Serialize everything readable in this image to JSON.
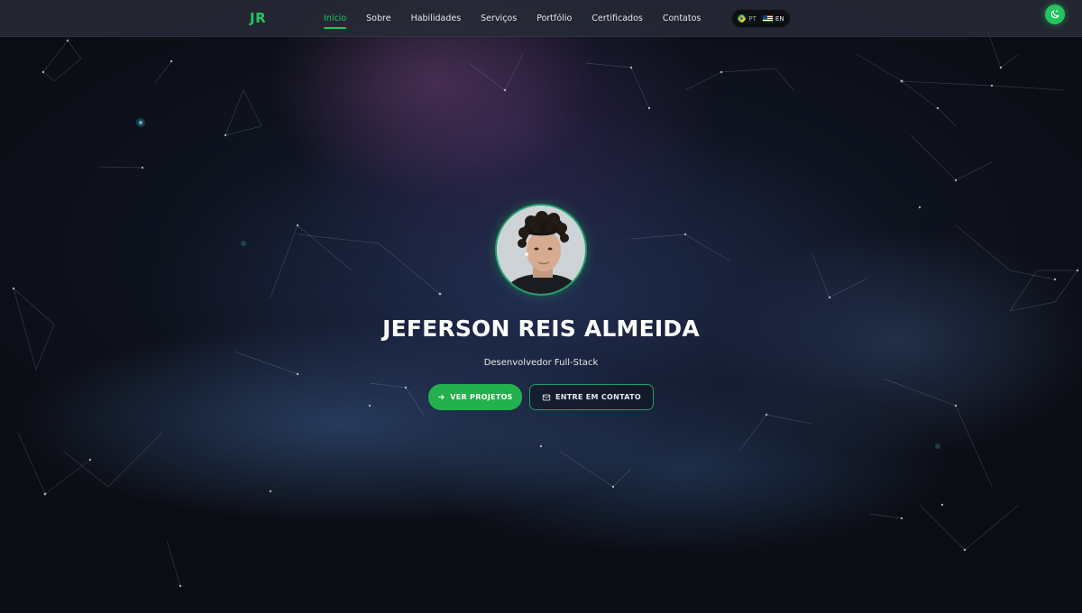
{
  "brand": {
    "logo": "JR",
    "accent": "#22c55e"
  },
  "nav": {
    "links": [
      {
        "label": "Início",
        "active": true
      },
      {
        "label": "Sobre"
      },
      {
        "label": "Habilidades"
      },
      {
        "label": "Serviços"
      },
      {
        "label": "Portfólio"
      },
      {
        "label": "Certificados"
      },
      {
        "label": "Contatos"
      }
    ]
  },
  "language": {
    "options": [
      {
        "code": "PT",
        "flag": "brazil-flag-icon"
      },
      {
        "code": "EN",
        "flag": "us-flag-icon"
      }
    ]
  },
  "theme_toggle": {
    "icon": "moon-stars-icon"
  },
  "hero": {
    "name": "JEFERSON REIS ALMEIDA",
    "role": "Desenvolvedor Full-Stack",
    "primary_button": {
      "label": "VER PROJETOS",
      "icon": "arrow-right-icon"
    },
    "secondary_button": {
      "label": "ENTRE EM CONTATO",
      "icon": "mail-icon"
    }
  }
}
